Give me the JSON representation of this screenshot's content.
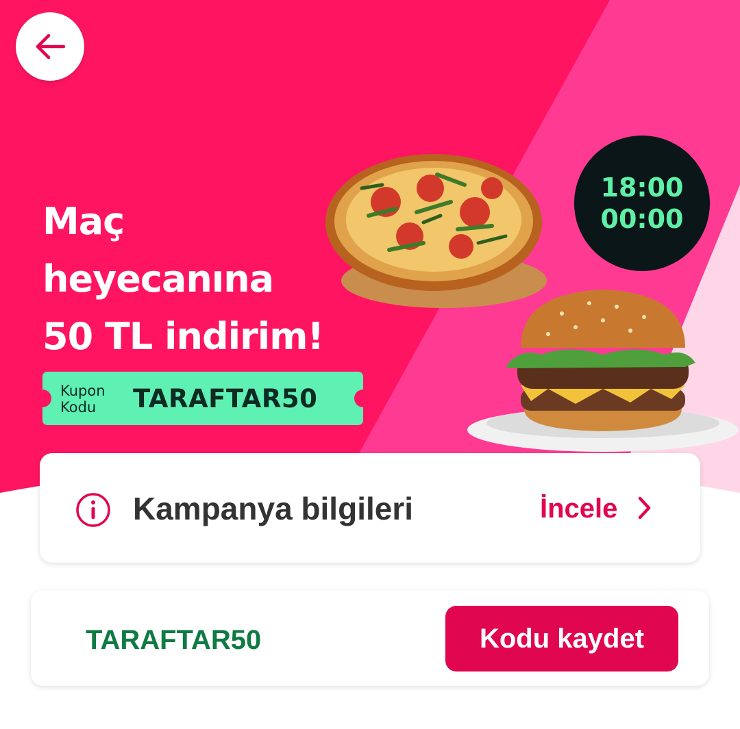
{
  "back": {
    "icon": "arrow-left-icon"
  },
  "banner": {
    "headline": [
      "Maç",
      "heyecanına",
      "50 TL indirim!"
    ],
    "coupon_label": [
      "Kupon",
      "Kodu"
    ],
    "coupon_code": "TARAFTAR50",
    "time_start": "18:00",
    "time_end": "00:00",
    "colors": {
      "primary": "#ff1462",
      "secondary": "#ff3a93",
      "badge": "#0b1618",
      "badge_text": "#5ff0a8",
      "coupon_bg": "#5ff0b4"
    }
  },
  "info": {
    "icon": "info-icon",
    "title": "Kampanya bilgileri",
    "link_label": "İncele",
    "chevron_icon": "chevron-right-icon"
  },
  "code_card": {
    "code": "TARAFTAR50",
    "button_label": "Kodu kaydet"
  },
  "colors": {
    "accent": "#e0064f",
    "code_green": "#0f7a43",
    "text_dark": "#333333"
  }
}
